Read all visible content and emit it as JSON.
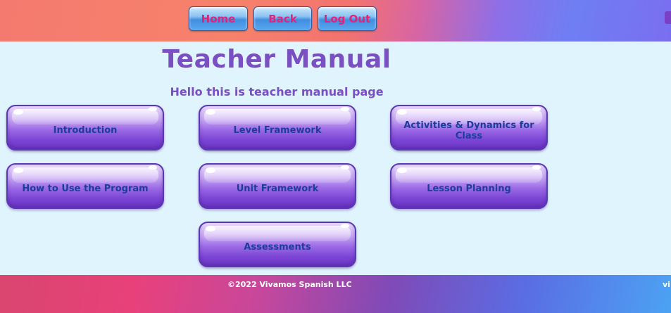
{
  "header": {
    "nav": {
      "home": "Home",
      "back": "Back",
      "logout": "Log Out"
    }
  },
  "main": {
    "title": "Teacher Manual",
    "subtitle": "Hello this is teacher manual page",
    "cards": [
      {
        "label": "Introduction"
      },
      {
        "label": "Level Framework"
      },
      {
        "label": "Activities & Dynamics for Class"
      },
      {
        "label": "How to Use the Program"
      },
      {
        "label": "Unit Framework"
      },
      {
        "label": "Lesson Planning"
      },
      {
        "label": "Assessments"
      }
    ]
  },
  "footer": {
    "copyright": "©2022 Vivamos Spanish LLC",
    "edge_text": "vi"
  },
  "colors": {
    "accent": "#7a4fc2",
    "nav_text": "#e0237c",
    "card_text": "#1c3d9c",
    "background": "#dff4fd"
  }
}
